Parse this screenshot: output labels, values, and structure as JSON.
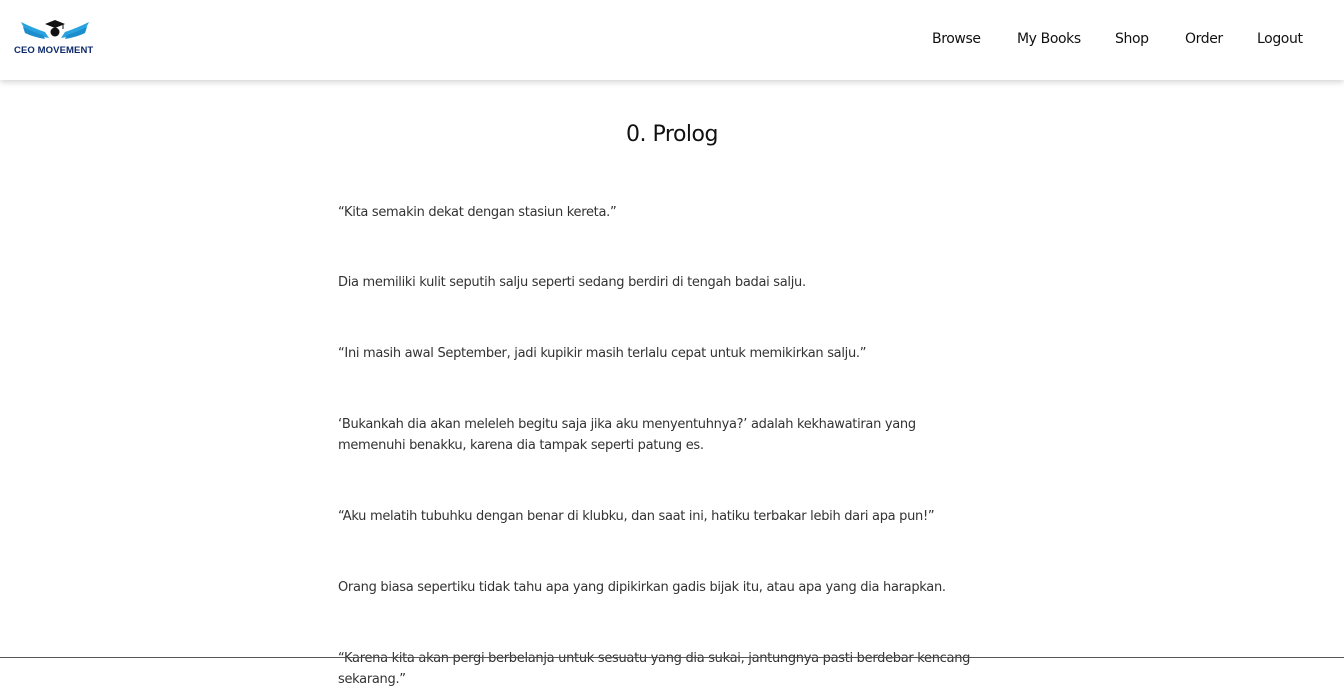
{
  "brand": {
    "name": "CEO MOVEMENT",
    "accent_color": "#29a3e0",
    "text_color": "#0d2a6b",
    "logo_icon": "graduation-cap-wings-icon"
  },
  "nav": {
    "items": [
      {
        "label": "Browse"
      },
      {
        "label": "My Books"
      },
      {
        "label": "Shop"
      },
      {
        "label": "Order"
      },
      {
        "label": "Logout"
      }
    ]
  },
  "chapter": {
    "title": "0. Prolog",
    "paragraphs": [
      "“Kita semakin dekat dengan stasiun kereta.”",
      "Dia memiliki kulit seputih salju seperti sedang berdiri di tengah badai salju.",
      "“Ini masih awal September, jadi kupikir masih terlalu cepat untuk memikirkan salju.”",
      "‘Bukankah dia akan meleleh begitu saja jika aku menyentuhnya?’ adalah kekhawatiran yang memenuhi benakku, karena dia tampak seperti patung es.",
      "“Aku melatih tubuhku dengan benar di klubku, dan saat ini, hatiku terbakar lebih dari apa pun!”",
      "Orang biasa sepertiku tidak tahu apa yang dipikirkan gadis bijak itu, atau apa yang dia harapkan.",
      "“Karena kita akan pergi berbelanja untuk sesuatu yang dia sukai, jantungnya pasti berdebar kencang sekarang.”"
    ]
  }
}
